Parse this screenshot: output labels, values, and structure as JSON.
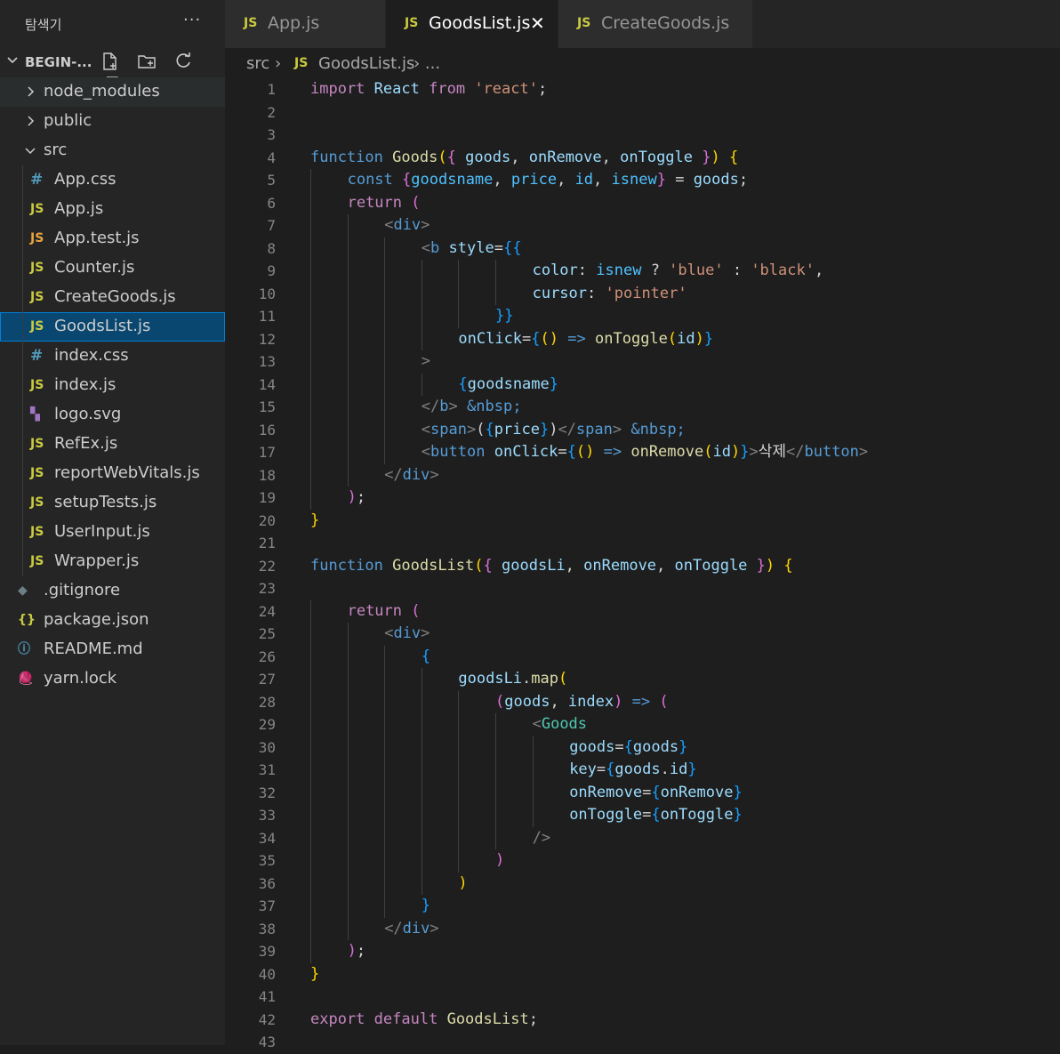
{
  "sidebar": {
    "title": "탐색기",
    "more_label": "···",
    "project": {
      "name": "BEGIN-..."
    },
    "tree": [
      {
        "name": "node_modules",
        "kind": "folder",
        "depth": 1,
        "expanded": false
      },
      {
        "name": "public",
        "kind": "folder",
        "depth": 1,
        "expanded": false
      },
      {
        "name": "src",
        "kind": "folder",
        "depth": 1,
        "expanded": true
      },
      {
        "name": "App.css",
        "kind": "css",
        "depth": 2,
        "icon": "#"
      },
      {
        "name": "App.js",
        "kind": "js",
        "depth": 2,
        "icon": "JS"
      },
      {
        "name": "App.test.js",
        "kind": "jsr",
        "depth": 2,
        "icon": "JS"
      },
      {
        "name": "Counter.js",
        "kind": "js",
        "depth": 2,
        "icon": "JS"
      },
      {
        "name": "CreateGoods.js",
        "kind": "js",
        "depth": 2,
        "icon": "JS"
      },
      {
        "name": "GoodsList.js",
        "kind": "js",
        "depth": 2,
        "icon": "JS",
        "selected": true
      },
      {
        "name": "index.css",
        "kind": "css",
        "depth": 2,
        "icon": "#"
      },
      {
        "name": "index.js",
        "kind": "js",
        "depth": 2,
        "icon": "JS"
      },
      {
        "name": "logo.svg",
        "kind": "svg",
        "depth": 2,
        "icon": "▚"
      },
      {
        "name": "RefEx.js",
        "kind": "js",
        "depth": 2,
        "icon": "JS"
      },
      {
        "name": "reportWebVitals.js",
        "kind": "js",
        "depth": 2,
        "icon": "JS"
      },
      {
        "name": "setupTests.js",
        "kind": "js",
        "depth": 2,
        "icon": "JS"
      },
      {
        "name": "UserInput.js",
        "kind": "js",
        "depth": 2,
        "icon": "JS"
      },
      {
        "name": "Wrapper.js",
        "kind": "js",
        "depth": 2,
        "icon": "JS"
      },
      {
        "name": ".gitignore",
        "kind": "git",
        "depth": 1,
        "icon": "◆"
      },
      {
        "name": "package.json",
        "kind": "json",
        "depth": 1,
        "icon": "{}"
      },
      {
        "name": "README.md",
        "kind": "info",
        "depth": 1,
        "icon": "ⓘ"
      },
      {
        "name": "yarn.lock",
        "kind": "yarn",
        "depth": 1,
        "icon": "🧶"
      }
    ]
  },
  "tabs": [
    {
      "label": "App.js",
      "icon": "JS",
      "active": false
    },
    {
      "label": "GoodsList.js",
      "icon": "JS",
      "active": true,
      "close": "✕"
    },
    {
      "label": "CreateGoods.js",
      "icon": "JS",
      "active": false
    }
  ],
  "breadcrumb": {
    "folder": "src",
    "sep": "›",
    "icon": "JS",
    "file": "GoodsList.js",
    "tail": "›  ..."
  },
  "colors": {
    "editor_bg": "#1e1e1e",
    "sidebar_bg": "#252526",
    "selection": "#094771",
    "keyword": "#569cd6",
    "control": "#c586c0",
    "function": "#dcdcaa",
    "variable": "#9cdcfe",
    "string": "#ce9178",
    "component": "#4ec9b0"
  },
  "code_lines": [
    {
      "n": "1",
      "indent": 0,
      "tokens": [
        [
          "import",
          "kw2"
        ],
        [
          " "
        ],
        [
          "React",
          "var"
        ],
        [
          " "
        ],
        [
          "from",
          "kw2"
        ],
        [
          " "
        ],
        [
          "'react'",
          "str"
        ],
        [
          ";"
        ]
      ]
    },
    {
      "n": "2",
      "indent": 0,
      "tokens": []
    },
    {
      "n": "3",
      "indent": 0,
      "tokens": []
    },
    {
      "n": "4",
      "indent": 0,
      "tokens": [
        [
          "function",
          "kw"
        ],
        [
          " "
        ],
        [
          "Goods",
          "fn"
        ],
        [
          "(",
          "y"
        ],
        [
          "{",
          "pk"
        ],
        [
          " "
        ],
        [
          "goods",
          "var"
        ],
        [
          ", "
        ],
        [
          "onRemove",
          "var"
        ],
        [
          ", "
        ],
        [
          "onToggle",
          "var"
        ],
        [
          " "
        ],
        [
          "}",
          "pk"
        ],
        [
          ")",
          "y"
        ],
        [
          " "
        ],
        [
          "{",
          "y"
        ]
      ]
    },
    {
      "n": "5",
      "indent": 1,
      "tokens": [
        [
          "const",
          "kw"
        ],
        [
          " "
        ],
        [
          "{",
          "pk"
        ],
        [
          "goodsname",
          "cls"
        ],
        [
          ", "
        ],
        [
          "price",
          "cls"
        ],
        [
          ", "
        ],
        [
          "id",
          "cls"
        ],
        [
          ", "
        ],
        [
          "isnew",
          "cls"
        ],
        [
          "}",
          "pk"
        ],
        [
          " = "
        ],
        [
          "goods",
          "var"
        ],
        [
          ";"
        ]
      ]
    },
    {
      "n": "6",
      "indent": 1,
      "tokens": [
        [
          "return",
          "kw2"
        ],
        [
          " "
        ],
        [
          "(",
          "pk"
        ]
      ]
    },
    {
      "n": "7",
      "indent": 2,
      "tokens": [
        [
          "<",
          "br"
        ],
        [
          "div",
          "tag"
        ],
        [
          ">",
          "br"
        ]
      ]
    },
    {
      "n": "8",
      "indent": 3,
      "tokens": [
        [
          "<",
          "br"
        ],
        [
          "b",
          "tag"
        ],
        [
          " "
        ],
        [
          "style",
          "var"
        ],
        [
          "="
        ],
        [
          "{{",
          "bl"
        ]
      ]
    },
    {
      "n": "9",
      "indent": 6,
      "tokens": [
        [
          "color",
          "var"
        ],
        [
          ": "
        ],
        [
          "isnew",
          "cls"
        ],
        [
          " ? "
        ],
        [
          "'blue'",
          "str"
        ],
        [
          " : "
        ],
        [
          "'black'",
          "str"
        ],
        [
          ","
        ]
      ]
    },
    {
      "n": "10",
      "indent": 6,
      "tokens": [
        [
          "cursor",
          "var"
        ],
        [
          ": "
        ],
        [
          "'pointer'",
          "str"
        ]
      ]
    },
    {
      "n": "11",
      "indent": 5,
      "tokens": [
        [
          "}}",
          "bl"
        ]
      ]
    },
    {
      "n": "12",
      "indent": 4,
      "tokens": [
        [
          "onClick",
          "var"
        ],
        [
          "="
        ],
        [
          "{",
          "bl"
        ],
        [
          "()",
          "y"
        ],
        [
          " "
        ],
        [
          "=>",
          "kw"
        ],
        [
          " "
        ],
        [
          "onToggle",
          "fn"
        ],
        [
          "(",
          "y"
        ],
        [
          "id",
          "var"
        ],
        [
          ")",
          "y"
        ],
        [
          "}",
          "bl"
        ]
      ]
    },
    {
      "n": "13",
      "indent": 3,
      "tokens": [
        [
          ">",
          "br"
        ]
      ]
    },
    {
      "n": "14",
      "indent": 4,
      "tokens": [
        [
          "{",
          "bl"
        ],
        [
          "goodsname",
          "var"
        ],
        [
          "}",
          "bl"
        ]
      ]
    },
    {
      "n": "15",
      "indent": 3,
      "tokens": [
        [
          "</",
          "br"
        ],
        [
          "b",
          "tag"
        ],
        [
          ">",
          "br"
        ],
        [
          " "
        ],
        [
          "&nbsp;",
          "tag"
        ]
      ]
    },
    {
      "n": "16",
      "indent": 3,
      "tokens": [
        [
          "<",
          "br"
        ],
        [
          "span",
          "tag"
        ],
        [
          ">",
          "br"
        ],
        [
          "("
        ],
        [
          "{",
          "bl"
        ],
        [
          "price",
          "var"
        ],
        [
          "}",
          "bl"
        ],
        [
          ")"
        ],
        [
          "</",
          "br"
        ],
        [
          "span",
          "tag"
        ],
        [
          ">",
          "br"
        ],
        [
          " "
        ],
        [
          "&nbsp;",
          "tag"
        ]
      ]
    },
    {
      "n": "17",
      "indent": 3,
      "tokens": [
        [
          "<",
          "br"
        ],
        [
          "button",
          "tag"
        ],
        [
          " "
        ],
        [
          "onClick",
          "var"
        ],
        [
          "="
        ],
        [
          "{",
          "bl"
        ],
        [
          "()",
          "y"
        ],
        [
          " "
        ],
        [
          "=>",
          "kw"
        ],
        [
          " "
        ],
        [
          "onRemove",
          "fn"
        ],
        [
          "(",
          "y"
        ],
        [
          "id",
          "var"
        ],
        [
          ")",
          "y"
        ],
        [
          "}",
          "bl"
        ],
        [
          ">",
          "br"
        ],
        [
          "삭제",
          "p"
        ],
        [
          "</",
          "br"
        ],
        [
          "button",
          "tag"
        ],
        [
          ">",
          "br"
        ]
      ]
    },
    {
      "n": "18",
      "indent": 2,
      "tokens": [
        [
          "</",
          "br"
        ],
        [
          "div",
          "tag"
        ],
        [
          ">",
          "br"
        ]
      ]
    },
    {
      "n": "19",
      "indent": 1,
      "tokens": [
        [
          ")",
          "pk"
        ],
        [
          ";"
        ]
      ]
    },
    {
      "n": "20",
      "indent": 0,
      "tokens": [
        [
          "}",
          "y"
        ]
      ]
    },
    {
      "n": "21",
      "indent": 0,
      "tokens": []
    },
    {
      "n": "22",
      "indent": 0,
      "tokens": [
        [
          "function",
          "kw"
        ],
        [
          " "
        ],
        [
          "GoodsList",
          "fn"
        ],
        [
          "(",
          "y"
        ],
        [
          "{",
          "pk"
        ],
        [
          " "
        ],
        [
          "goodsLi",
          "var"
        ],
        [
          ", "
        ],
        [
          "onRemove",
          "var"
        ],
        [
          ", "
        ],
        [
          "onToggle",
          "var"
        ],
        [
          " "
        ],
        [
          "}",
          "pk"
        ],
        [
          ")",
          "y"
        ],
        [
          " "
        ],
        [
          "{",
          "y"
        ]
      ]
    },
    {
      "n": "23",
      "indent": 0,
      "tokens": []
    },
    {
      "n": "24",
      "indent": 1,
      "tokens": [
        [
          "return",
          "kw2"
        ],
        [
          " "
        ],
        [
          "(",
          "pk"
        ]
      ]
    },
    {
      "n": "25",
      "indent": 2,
      "tokens": [
        [
          "<",
          "br"
        ],
        [
          "div",
          "tag"
        ],
        [
          ">",
          "br"
        ]
      ]
    },
    {
      "n": "26",
      "indent": 3,
      "tokens": [
        [
          "{",
          "bl"
        ]
      ]
    },
    {
      "n": "27",
      "indent": 4,
      "tokens": [
        [
          "goodsLi",
          "var"
        ],
        [
          "."
        ],
        [
          "map",
          "fn"
        ],
        [
          "(",
          "y"
        ]
      ]
    },
    {
      "n": "28",
      "indent": 5,
      "tokens": [
        [
          "(",
          "pk"
        ],
        [
          "goods",
          "var"
        ],
        [
          ", "
        ],
        [
          "index",
          "var"
        ],
        [
          ")",
          "pk"
        ],
        [
          " "
        ],
        [
          "=>",
          "kw"
        ],
        [
          " "
        ],
        [
          "(",
          "pk"
        ]
      ]
    },
    {
      "n": "29",
      "indent": 6,
      "tokens": [
        [
          "<",
          "br"
        ],
        [
          "Goods",
          "comp"
        ]
      ]
    },
    {
      "n": "30",
      "indent": 7,
      "tokens": [
        [
          "goods",
          "var"
        ],
        [
          "="
        ],
        [
          "{",
          "bl"
        ],
        [
          "goods",
          "var"
        ],
        [
          "}",
          "bl"
        ]
      ]
    },
    {
      "n": "31",
      "indent": 7,
      "tokens": [
        [
          "key",
          "var"
        ],
        [
          "="
        ],
        [
          "{",
          "bl"
        ],
        [
          "goods",
          "var"
        ],
        [
          "."
        ],
        [
          "id",
          "var"
        ],
        [
          "}",
          "bl"
        ]
      ]
    },
    {
      "n": "32",
      "indent": 7,
      "tokens": [
        [
          "onRemove",
          "var"
        ],
        [
          "="
        ],
        [
          "{",
          "bl"
        ],
        [
          "onRemove",
          "var"
        ],
        [
          "}",
          "bl"
        ]
      ]
    },
    {
      "n": "33",
      "indent": 7,
      "tokens": [
        [
          "onToggle",
          "var"
        ],
        [
          "="
        ],
        [
          "{",
          "bl"
        ],
        [
          "onToggle",
          "var"
        ],
        [
          "}",
          "bl"
        ]
      ]
    },
    {
      "n": "34",
      "indent": 6,
      "tokens": [
        [
          "/>",
          "br"
        ]
      ]
    },
    {
      "n": "35",
      "indent": 5,
      "tokens": [
        [
          ")",
          "pk"
        ]
      ]
    },
    {
      "n": "36",
      "indent": 4,
      "tokens": [
        [
          ")",
          "y"
        ]
      ]
    },
    {
      "n": "37",
      "indent": 3,
      "tokens": [
        [
          "}",
          "bl"
        ]
      ]
    },
    {
      "n": "38",
      "indent": 2,
      "tokens": [
        [
          "</",
          "br"
        ],
        [
          "div",
          "tag"
        ],
        [
          ">",
          "br"
        ]
      ]
    },
    {
      "n": "39",
      "indent": 1,
      "tokens": [
        [
          ")",
          "pk"
        ],
        [
          ";"
        ]
      ]
    },
    {
      "n": "40",
      "indent": 0,
      "tokens": [
        [
          "}",
          "y"
        ]
      ]
    },
    {
      "n": "41",
      "indent": 0,
      "tokens": []
    },
    {
      "n": "42",
      "indent": 0,
      "tokens": [
        [
          "export",
          "kw2"
        ],
        [
          " "
        ],
        [
          "default",
          "kw2"
        ],
        [
          " "
        ],
        [
          "GoodsList",
          "fn"
        ],
        [
          ";"
        ]
      ]
    },
    {
      "n": "43",
      "indent": 0,
      "tokens": []
    }
  ]
}
